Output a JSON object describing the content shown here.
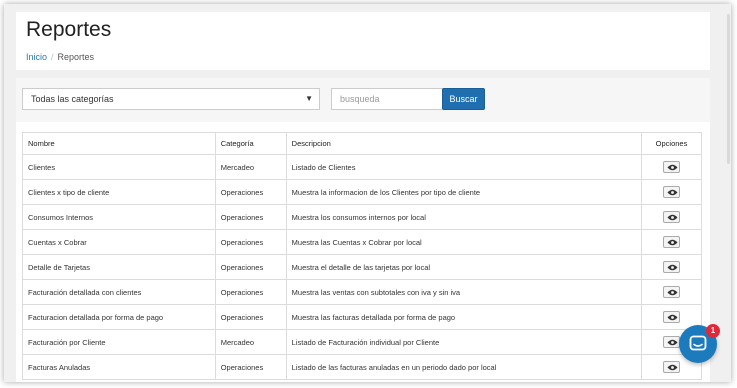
{
  "page": {
    "title": "Reportes",
    "breadcrumb": {
      "home": "Inicio",
      "separator": "/",
      "current": "Reportes"
    }
  },
  "toolbar": {
    "category_selected": "Todas las categorías",
    "search_placeholder": "busqueda",
    "search_button": "Buscar"
  },
  "table": {
    "headers": [
      "Nombre",
      "Categoría",
      "Descripcion",
      "Opciones"
    ],
    "rows": [
      {
        "nombre": "Clientes",
        "categoria": "Mercadeo",
        "descripcion": "Listado de Clientes"
      },
      {
        "nombre": "Clientes x tipo de cliente",
        "categoria": "Operaciones",
        "descripcion": "Muestra la informacion de los Clientes por tipo de cliente"
      },
      {
        "nombre": "Consumos Internos",
        "categoria": "Operaciones",
        "descripcion": "Muestra los consumos internos por local"
      },
      {
        "nombre": "Cuentas x Cobrar",
        "categoria": "Operaciones",
        "descripcion": "Muestra las Cuentas x Cobrar por local"
      },
      {
        "nombre": "Detalle de Tarjetas",
        "categoria": "Operaciones",
        "descripcion": "Muestra el detalle de las tarjetas por local"
      },
      {
        "nombre": "Facturación detallada con clientes",
        "categoria": "Operaciones",
        "descripcion": "Muestra las ventas con subtotales con iva y sin iva"
      },
      {
        "nombre": "Facturacion detallada por forma de pago",
        "categoria": "Operaciones",
        "descripcion": "Muestra las facturas detallada por forma de pago"
      },
      {
        "nombre": "Facturación por Cliente",
        "categoria": "Mercadeo",
        "descripcion": "Listado de Facturación individual por Cliente"
      },
      {
        "nombre": "Facturas Anuladas",
        "categoria": "Operaciones",
        "descripcion": "Listado de las facturas anuladas en un periodo dado por local"
      }
    ]
  },
  "chat": {
    "badge_count": "1"
  },
  "icons": {
    "view": "eye-icon",
    "chat": "chat-icon",
    "dropdown": "chevron-down-icon"
  },
  "colors": {
    "accent": "#1f6fb0",
    "link": "#2a7ab0",
    "badge": "#e0283a",
    "chat": "#1b7bbd"
  }
}
